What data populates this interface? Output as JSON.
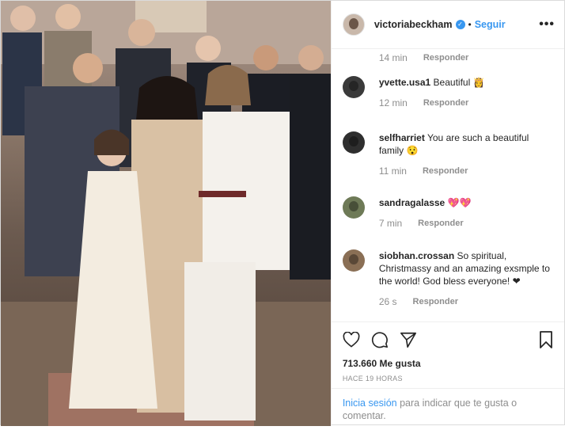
{
  "header": {
    "username": "victoriabeckham",
    "separator": "•",
    "follow_label": "Seguir",
    "more": "•••"
  },
  "first_comment_meta": {
    "time": "14 min",
    "reply": "Responder"
  },
  "comments": [
    {
      "user": "yvette.usa1",
      "text": "Beautiful 👸",
      "time": "12 min",
      "reply": "Responder",
      "avatar_color": "#3a3a3a"
    },
    {
      "user": "selfharriet",
      "text": "You are such a beautiful family 😯",
      "time": "11 min",
      "reply": "Responder",
      "avatar_color": "#2f2f2f"
    },
    {
      "user": "sandragalasse",
      "text": "💖💖",
      "time": "7 min",
      "reply": "Responder",
      "avatar_color": "#6e7a57"
    },
    {
      "user": "siobhan.crossan",
      "text": "So spiritual, Christmassy and an amazing exsmple to the world! God bless everyone! ❤",
      "time": "26 s",
      "reply": "Responder",
      "avatar_color": "#8a6f55"
    }
  ],
  "actions": {
    "likes": "713.660 Me gusta",
    "posted": "HACE 19 HORAS"
  },
  "login": {
    "link": "Inicia sesión",
    "text": " para indicar que te gusta o comentar."
  },
  "colors": {
    "accent": "#3897f0",
    "text": "#262626",
    "muted": "#8e8e8e",
    "heart": "#ed4956"
  }
}
